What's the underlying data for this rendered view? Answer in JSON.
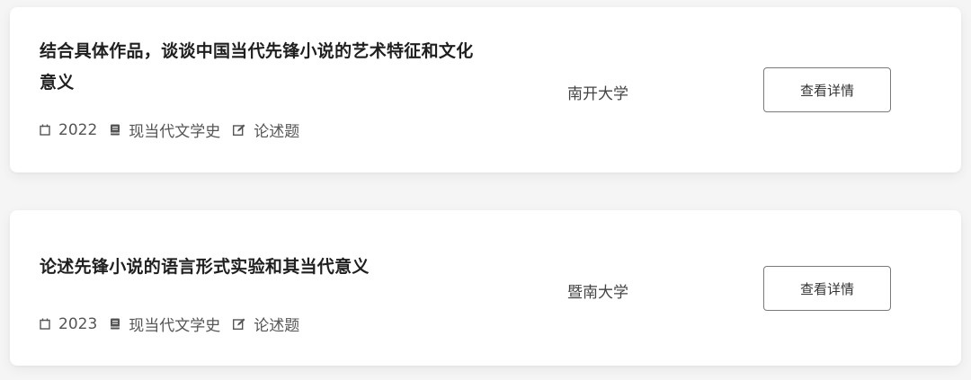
{
  "questions": [
    {
      "title": "结合具体作品，谈谈中国当代先锋小说的艺术特征和文化意义",
      "year": "2022",
      "course": "现当代文学史",
      "type": "论述题",
      "school": "南开大学",
      "button_label": "查看详情"
    },
    {
      "title": "论述先锋小说的语言形式实验和其当代意义",
      "year": "2023",
      "course": "现当代文学史",
      "type": "论述题",
      "school": "暨南大学",
      "button_label": "查看详情"
    }
  ],
  "icons": {
    "year": "calendar-icon",
    "course": "book-icon",
    "type": "edit-icon"
  },
  "colors": {
    "background": "#f5f5f5",
    "card": "#ffffff",
    "title": "#1f1f1f",
    "meta": "#555555",
    "button_border": "#7a7a7a"
  }
}
